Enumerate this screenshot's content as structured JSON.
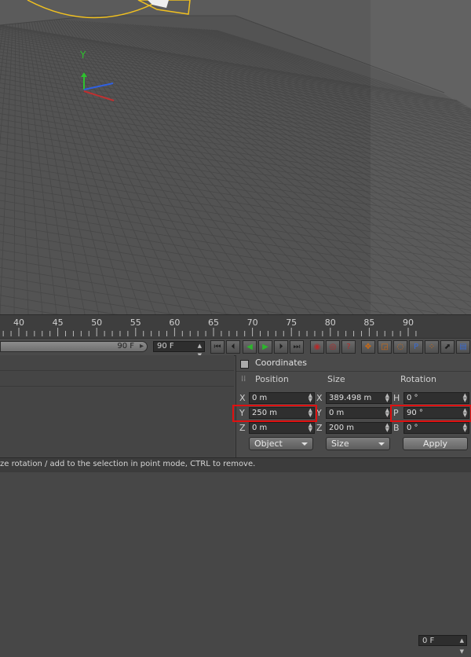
{
  "viewport": {
    "axis_y_label": "Y"
  },
  "timeline": {
    "ticks": [
      "40",
      "45",
      "50",
      "55",
      "60",
      "65",
      "70",
      "75",
      "80",
      "85",
      "90"
    ],
    "current_frame": "0 F"
  },
  "transport": {
    "slider_value": "90 F",
    "max_frame": "90 F",
    "buttons": [
      {
        "name": "go-to-start-button",
        "glyph": "⏮",
        "color": ""
      },
      {
        "name": "previous-key-button",
        "glyph": "⏴",
        "color": ""
      },
      {
        "name": "play-backwards-button",
        "glyph": "◀",
        "color": "green"
      },
      {
        "name": "play-forwards-button",
        "glyph": "▶",
        "color": "green"
      },
      {
        "name": "next-key-button",
        "glyph": "⏵",
        "color": ""
      },
      {
        "name": "go-to-end-button",
        "glyph": "⏭",
        "color": ""
      },
      {
        "name": "record-keys-button",
        "glyph": "◉",
        "color": "red"
      },
      {
        "name": "autokey-button",
        "glyph": "◎",
        "color": "red"
      },
      {
        "name": "keyframe-selection-button",
        "glyph": "?",
        "color": "red"
      },
      {
        "name": "record-position-button",
        "glyph": "✥",
        "color": "orange"
      },
      {
        "name": "record-scale-button",
        "glyph": "◲",
        "color": "orange"
      },
      {
        "name": "record-rotation-button",
        "glyph": "◌",
        "color": "orange"
      },
      {
        "name": "record-parameter-button",
        "glyph": "P",
        "color": "blue"
      },
      {
        "name": "record-point-level-button",
        "glyph": "⁘",
        "color": "orange"
      },
      {
        "name": "interpolation-button",
        "glyph": "⬈",
        "color": ""
      },
      {
        "name": "scheme-button",
        "glyph": "▤",
        "color": "blue"
      }
    ]
  },
  "coordinates": {
    "title": "Coordinates",
    "headers": {
      "position": "Position",
      "size": "Size",
      "rotation": "Rotation"
    },
    "position": {
      "x_axis": "X",
      "x": "0 m",
      "y_axis": "Y",
      "y": "250 m",
      "z_axis": "Z",
      "z": "0 m"
    },
    "size": {
      "x_axis": "X",
      "x": "389.498 m",
      "y_axis": "Y",
      "y": "0 m",
      "z_axis": "Z",
      "z": "200 m"
    },
    "rotation": {
      "h_axis": "H",
      "h": "0 °",
      "p_axis": "P",
      "p": "90 °",
      "b_axis": "B",
      "b": "0 °"
    },
    "mode_dropdown": "Object",
    "size_dropdown": "Size",
    "apply_label": "Apply"
  },
  "status_text": "ze rotation / add to the selection in point mode, CTRL to remove.",
  "colors": {
    "highlight": "#e01010",
    "object_outline": "#f0c020",
    "axis_y": "#2ec12e",
    "axis_x": "#c03030",
    "axis_z": "#3060e0"
  }
}
